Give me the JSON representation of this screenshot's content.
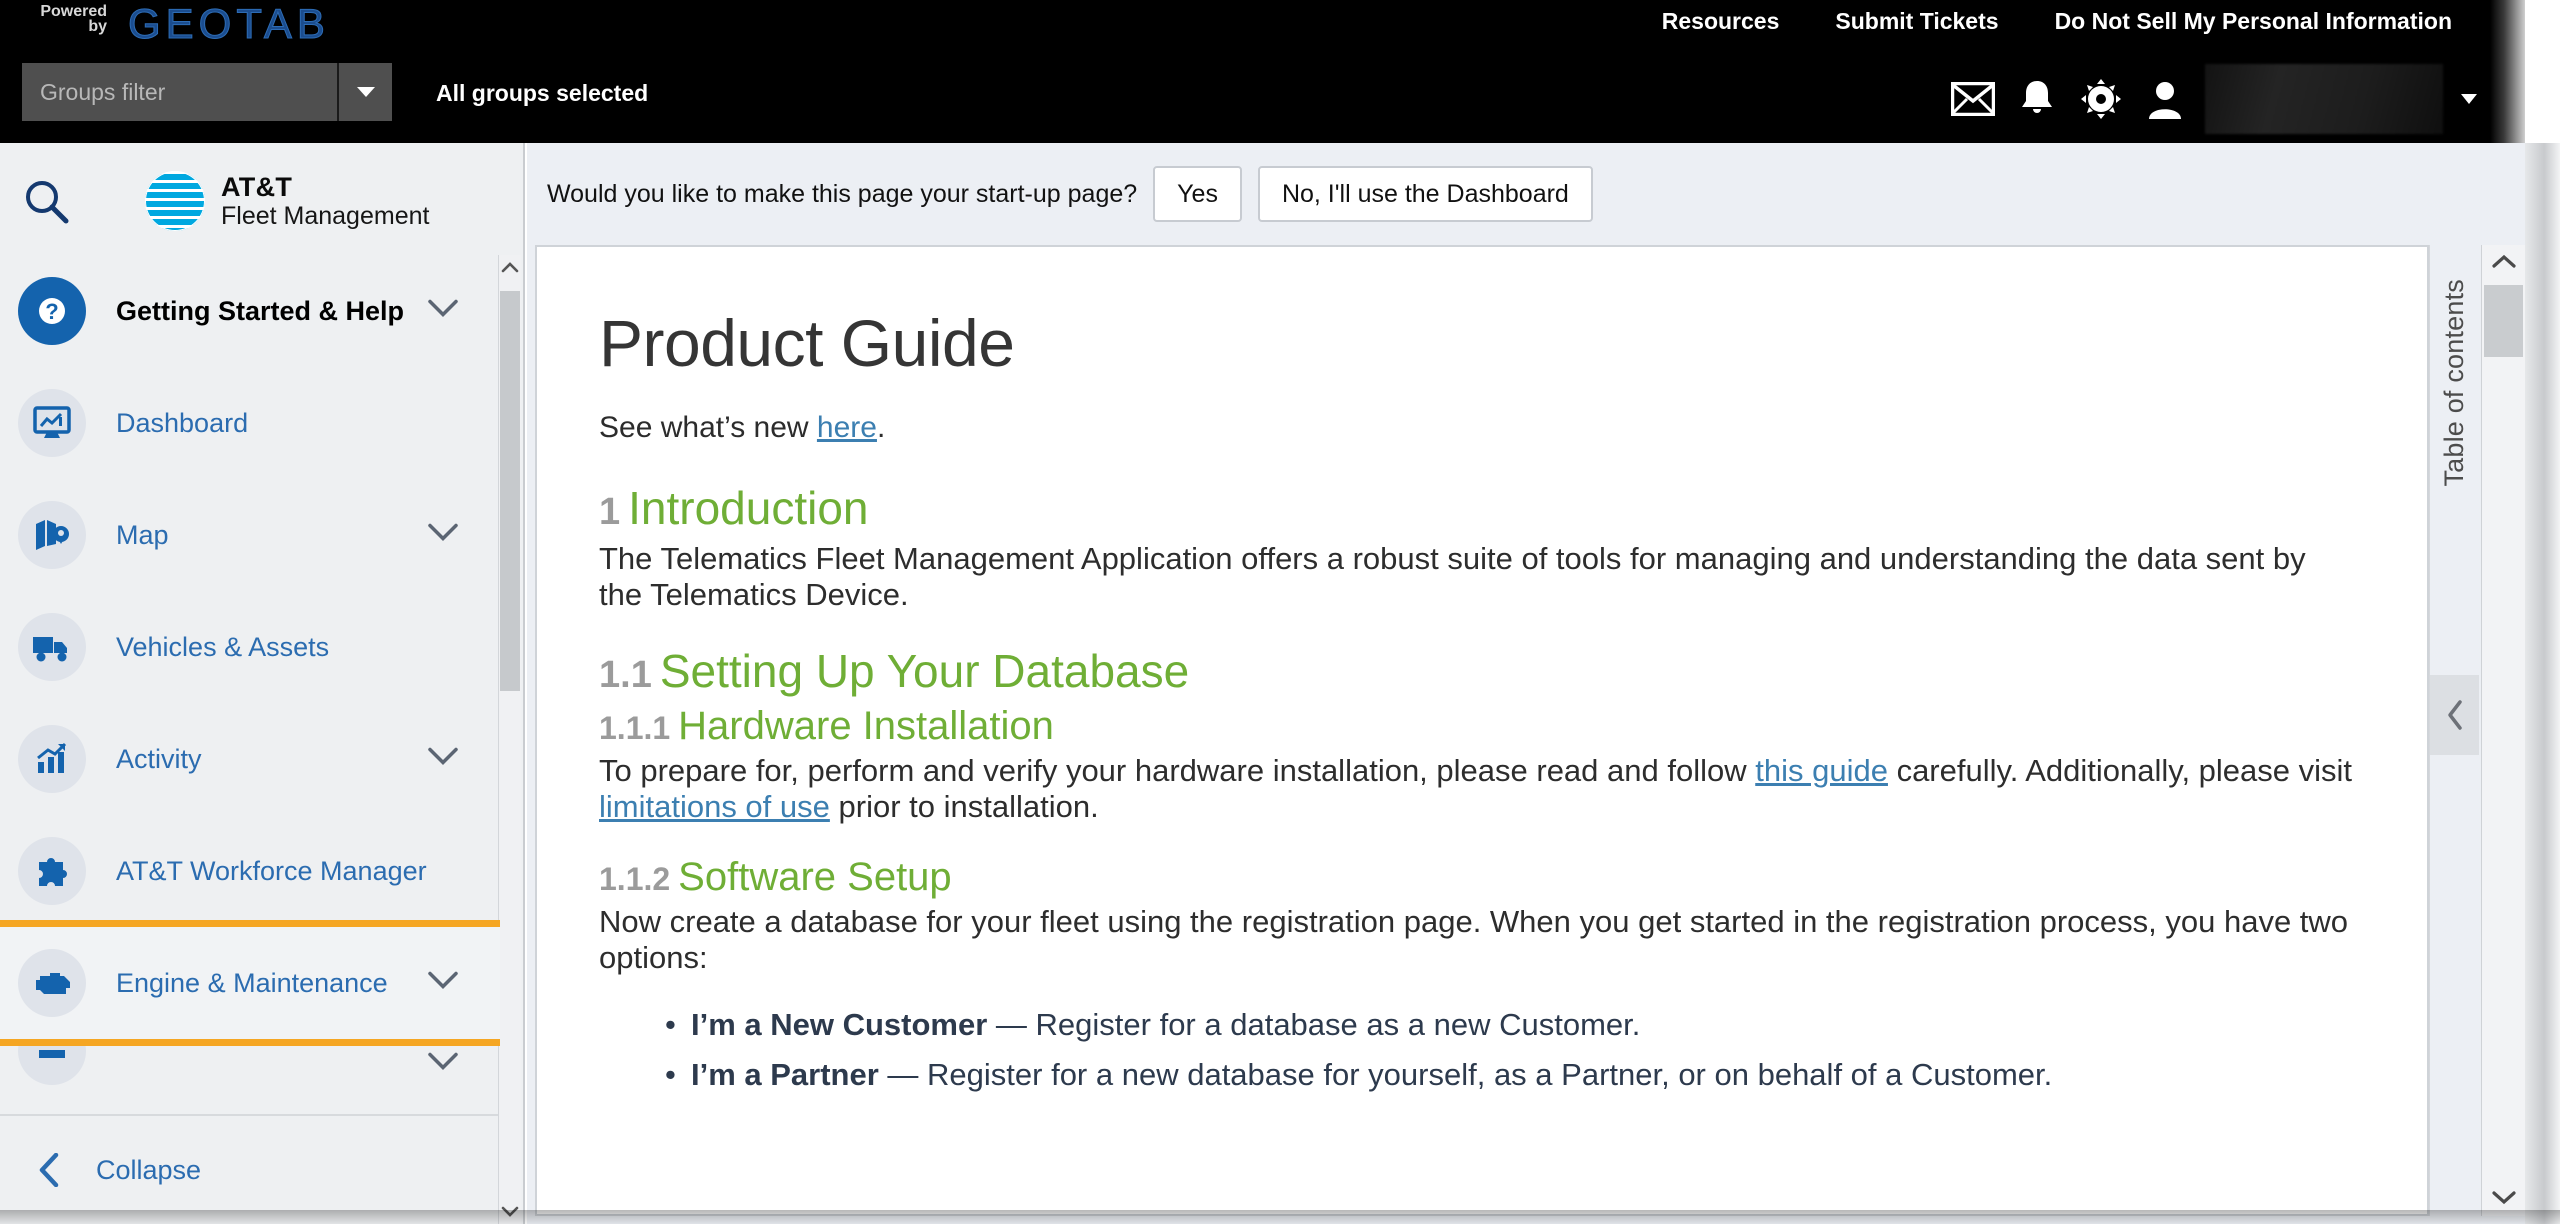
{
  "topbar": {
    "powered_line1": "Powered",
    "powered_line2": "by",
    "brand": "GEOTAB",
    "groups_filter_placeholder": "Groups filter",
    "groups_filter_value": "",
    "all_groups_status": "All groups selected",
    "links": [
      {
        "label": "Resources"
      },
      {
        "label": "Submit Tickets"
      },
      {
        "label": "Do Not Sell My Personal Information"
      }
    ],
    "icons": [
      {
        "name": "mail-icon",
        "glyph": "✉"
      },
      {
        "name": "bell-icon",
        "glyph": "🔔"
      },
      {
        "name": "gear-icon",
        "glyph": "⚙"
      },
      {
        "name": "user-icon",
        "glyph": "👤"
      }
    ],
    "user_name": ""
  },
  "sidebar": {
    "search_icon": "search-icon",
    "brand_line1": "AT&T",
    "brand_line2": "Fleet Management",
    "items": [
      {
        "label": "Getting Started & Help",
        "icon": "question-mark-icon",
        "chevron": true,
        "active": true
      },
      {
        "label": "Dashboard",
        "icon": "dashboard-monitor-icon",
        "chevron": false,
        "active": false
      },
      {
        "label": "Map",
        "icon": "map-pin-icon",
        "chevron": true,
        "active": false
      },
      {
        "label": "Vehicles & Assets",
        "icon": "truck-icon",
        "chevron": false,
        "active": false
      },
      {
        "label": "Activity",
        "icon": "bar-chart-icon",
        "chevron": true,
        "active": false
      },
      {
        "label": "AT&T Workforce Manager",
        "icon": "puzzle-piece-icon",
        "chevron": false,
        "active": false
      },
      {
        "label": "Engine & Maintenance",
        "icon": "engine-icon",
        "chevron": true,
        "active": false,
        "highlighted": true
      },
      {
        "label": "",
        "icon": "partial-icon",
        "chevron": true,
        "active": false,
        "cutoff": true
      }
    ],
    "collapse_label": "Collapse"
  },
  "startup_prompt": {
    "question": "Would you like to make this page your start-up page?",
    "yes_label": "Yes",
    "no_label": "No, I'll use the Dashboard"
  },
  "document": {
    "title": "Product Guide",
    "see_whats_new_prefix": "See what’s new ",
    "see_whats_new_link": "here",
    "see_whats_new_suffix": ".",
    "sections": [
      {
        "num": "1",
        "heading": "Introduction",
        "body": "The Telematics Fleet Management Application offers a robust suite of tools for managing and understanding the data sent by the Telematics Device."
      },
      {
        "num": "1.1",
        "heading": "Setting Up Your Database"
      },
      {
        "num": "1.1.1",
        "heading": "Hardware Installation",
        "body_part1": "To prepare for, perform and verify your hardware installation, please read and follow ",
        "link1": "this guide",
        "body_part2": " carefully. Additionally, please visit ",
        "link2": "limitations of use",
        "body_part3": " prior to installation."
      },
      {
        "num": "1.1.2",
        "heading": "Software Setup",
        "body": "Now create a database for your fleet using the registration page. When you get started in the registration process, you have two options:"
      }
    ],
    "options": [
      {
        "bold": "I’m a New Customer",
        "rest": " — Register for a database as a new Customer."
      },
      {
        "bold": "I’m a Partner",
        "rest": " — Register for a new database for yourself, as a Partner, or on behalf of a Customer."
      }
    ]
  },
  "toc": {
    "label": "Table of contents",
    "collapse_icon": "chevron-left-icon"
  },
  "colors": {
    "heading_green": "#6fae36",
    "link_blue": "#3c7fb1",
    "highlight_orange": "#f5a623",
    "nav_blue": "#2b6cb0",
    "att_blue": "#00a8e0"
  }
}
